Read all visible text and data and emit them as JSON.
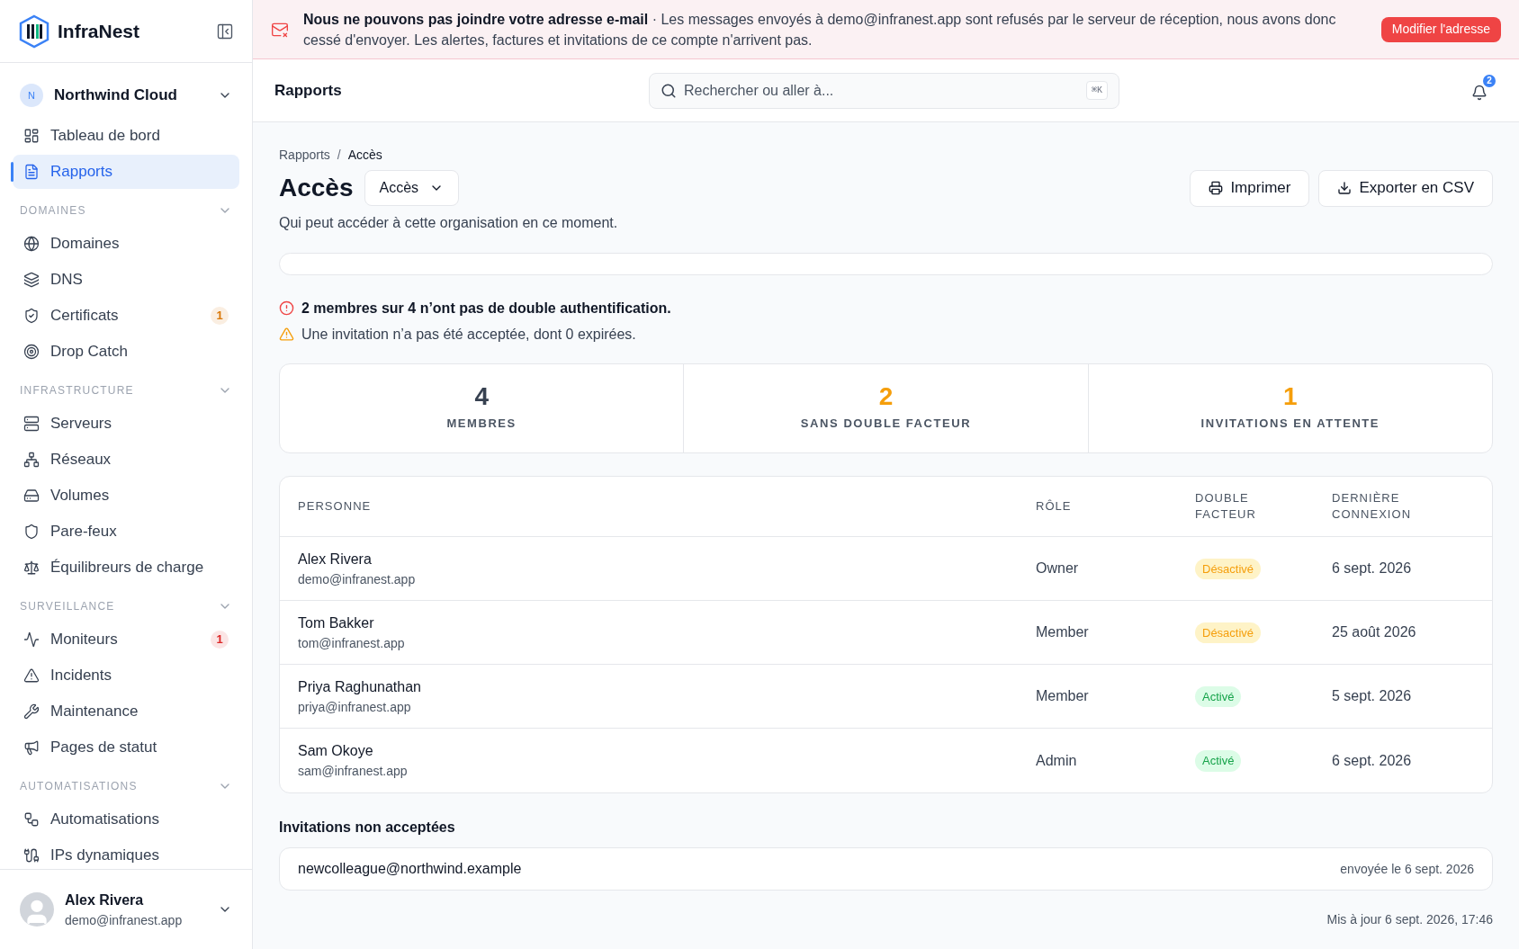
{
  "sidebar": {
    "brand": "InfraNest",
    "org": {
      "initial": "N",
      "name": "Northwind Cloud"
    },
    "top_items": [
      {
        "label": "Tableau de bord",
        "selected": false
      },
      {
        "label": "Rapports",
        "selected": true
      }
    ],
    "sections": [
      {
        "label": "DOMAINES",
        "expanded": true,
        "items": [
          {
            "label": "Domaines",
            "selected": false
          },
          {
            "label": "DNS",
            "selected": false
          },
          {
            "label": "Certificats",
            "selected": false,
            "badge": {
              "text": "1",
              "color": "#d97706"
            }
          },
          {
            "label": "Drop Catch",
            "selected": false
          }
        ]
      },
      {
        "label": "INFRASTRUCTURE",
        "expanded": true,
        "items": [
          {
            "label": "Serveurs",
            "selected": false
          },
          {
            "label": "Réseaux",
            "selected": false
          },
          {
            "label": "Volumes",
            "selected": false
          },
          {
            "label": "Pare-feux",
            "selected": false
          },
          {
            "label": "Équilibreurs de charge",
            "selected": false
          }
        ]
      },
      {
        "label": "SURVEILLANCE",
        "expanded": true,
        "items": [
          {
            "label": "Moniteurs",
            "selected": false,
            "badge": {
              "text": "1",
              "color": "#dc2626"
            }
          },
          {
            "label": "Incidents",
            "selected": false
          },
          {
            "label": "Maintenance",
            "selected": false
          },
          {
            "label": "Pages de statut",
            "selected": false
          }
        ]
      },
      {
        "label": "AUTOMATISATIONS",
        "expanded": true,
        "items": [
          {
            "label": "Automatisations",
            "selected": false
          },
          {
            "label": "IPs dynamiques",
            "selected": false
          }
        ]
      }
    ],
    "user": {
      "name": "Alex Rivera",
      "email": "demo@infranest.app"
    }
  },
  "banner": {
    "text": "**Nous ne pouvons pas joindre votre adresse e-mail** · Les messages envoyés à demo@infranest.app sont refusés par le serveur de réception, nous avons donc cessé d'envoyer. Les alertes, factures et invitations de ce compte n'arrivent pas.",
    "button": "Modifier l'adresse"
  },
  "header": {
    "title": "Rapports",
    "search": {
      "placeholder": "Rechercher ou aller à...",
      "shortcut": "⌘K"
    },
    "notifications": "2"
  },
  "breadcrumb": {
    "separator": "/",
    "items": [
      "Rapports",
      "Accès"
    ]
  },
  "page": {
    "title": "Accès",
    "report_select": "Accès",
    "subtitle": "Qui peut accéder à cette organisation en ce moment.",
    "actions": [
      "Imprimer",
      "Exporter en CSV"
    ]
  },
  "alerts": [
    {
      "kind": "error",
      "text": "2 membres sur 4 n’ont pas de double authentification."
    },
    {
      "kind": "warning",
      "text": "Une invitation n’a pas été acceptée, dont 0 expirées."
    }
  ],
  "stats": [
    {
      "value": "4",
      "label": "MEMBRES",
      "color": "#374151"
    },
    {
      "value": "2",
      "label": "SANS DOUBLE FACTEUR",
      "color": "#f59e0b"
    },
    {
      "value": "1",
      "label": "INVITATIONS EN ATTENTE",
      "color": "#f59e0b"
    }
  ],
  "table": {
    "columns": [
      "PERSONNE",
      "RÔLE",
      "DOUBLE FACTEUR",
      "DERNIÈRE CONNEXION"
    ],
    "rows": [
      {
        "name": "Alex Rivera",
        "email": "demo@infranest.app",
        "role": "Owner",
        "two_factor": {
          "enabled": false,
          "text": "Désactivé"
        },
        "last_login": "6 sept. 2026"
      },
      {
        "name": "Tom Bakker",
        "email": "tom@infranest.app",
        "role": "Member",
        "two_factor": {
          "enabled": false,
          "text": "Désactivé"
        },
        "last_login": "25 août 2026"
      },
      {
        "name": "Priya Raghunathan",
        "email": "priya@infranest.app",
        "role": "Member",
        "two_factor": {
          "enabled": true,
          "text": "Activé"
        },
        "last_login": "5 sept. 2026"
      },
      {
        "name": "Sam Okoye",
        "email": "sam@infranest.app",
        "role": "Admin",
        "two_factor": {
          "enabled": true,
          "text": "Activé"
        },
        "last_login": "6 sept. 2026"
      }
    ]
  },
  "invitations": {
    "title": "Invitations non acceptées",
    "items": [
      {
        "email": "newcolleague@northwind.example",
        "sent": "envoyée le 6 sept. 2026"
      }
    ]
  },
  "updated": "Mis à jour 6 sept. 2026, 17:46"
}
